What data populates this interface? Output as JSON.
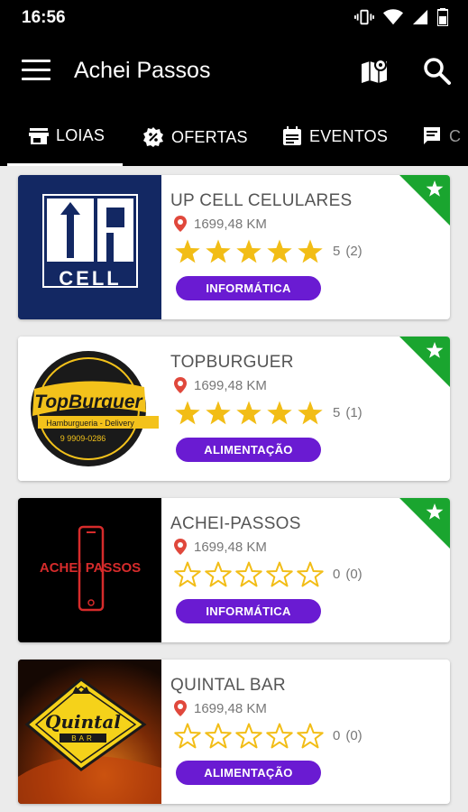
{
  "status_bar": {
    "time": "16:56"
  },
  "app_bar": {
    "title": "Achei Passos"
  },
  "tabs": [
    {
      "label": "LOIAS",
      "icon": "store-icon"
    },
    {
      "label": "OFERTAS",
      "icon": "discount-icon"
    },
    {
      "label": "EVENTOS",
      "icon": "calendar-icon"
    },
    {
      "label": "C",
      "icon": "chat-icon"
    }
  ],
  "stores": [
    {
      "name": "UP CELL CELULARES",
      "distance": "1699,48 KM",
      "rating": 5,
      "rating_label": "5",
      "reviews": "(2)",
      "category": "INFORMÁTICA",
      "featured": true,
      "logo_lines": [
        "UP",
        "CELL"
      ]
    },
    {
      "name": "TOPBURGUER",
      "distance": "1699,48 KM",
      "rating": 5,
      "rating_label": "5",
      "reviews": "(1)",
      "category": "ALIMENTAÇÃO",
      "featured": true,
      "logo_lines": [
        "TopBurguer",
        "Hamburgueria - Delivery",
        "9 9909-0286"
      ]
    },
    {
      "name": "ACHEI-PASSOS",
      "distance": "1699,48 KM",
      "rating": 0,
      "rating_label": "0",
      "reviews": "(0)",
      "category": "INFORMÁTICA",
      "featured": true,
      "logo_lines": [
        "ACHEI PASSOS"
      ]
    },
    {
      "name": "QUINTAL BAR",
      "distance": "1699,48 KM",
      "rating": 0,
      "rating_label": "0",
      "reviews": "(0)",
      "category": "ALIMENTAÇÃO",
      "featured": false,
      "logo_lines": [
        "Quintal",
        "BAR"
      ]
    }
  ],
  "colors": {
    "category_purple": "#6a1bd2",
    "featured_green": "#1aa52f",
    "star_gold": "#f2bd16",
    "pin_red": "#e0483c"
  }
}
